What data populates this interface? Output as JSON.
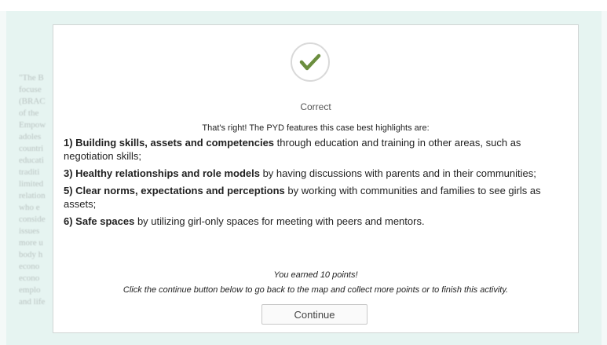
{
  "background": {
    "text_lines": [
      "\"The B",
      "focuse",
      "(BRAC",
      "of the",
      "Empow",
      "adoles",
      "countri",
      "educati",
      "traditi",
      "limited",
      "relation",
      "who e",
      "conside",
      "issues",
      "more u",
      "body h",
      "econo",
      "econo",
      "emplo",
      "and life"
    ]
  },
  "modal": {
    "icon": "checkmark-icon",
    "accent_color": "#6b8e3e",
    "result_title": "Correct",
    "intro": "That's right! The PYD features this case best highlights are:",
    "features": [
      {
        "bold": "1) Building skills, assets and competencies",
        "text": " through education and training in other areas, such as negotiation skills;"
      },
      {
        "bold": "3) Healthy relationships and role models",
        "text": " by having discussions with parents and in their communities;"
      },
      {
        "bold": "5) Clear norms, expectations and perceptions",
        "text": " by working with communities and families to see girls as assets;"
      },
      {
        "bold": "6) Safe spaces",
        "text": " by utilizing girl-only spaces for meeting with peers and mentors."
      }
    ],
    "points_message": "You earned 10 points!",
    "instruction": "Click the continue button below to go back to the map and collect more points or to finish this activity.",
    "continue_label": "Continue"
  }
}
